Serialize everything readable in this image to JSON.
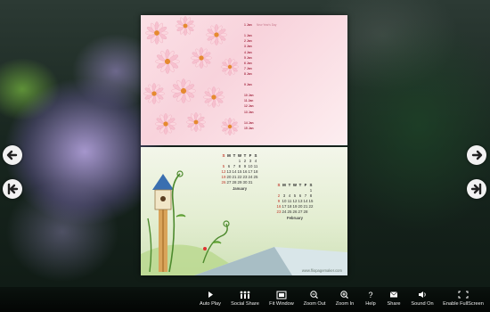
{
  "navigation": {
    "prev_icon": "arrow-left-icon",
    "first_icon": "skip-first-icon",
    "next_icon": "arrow-right-icon",
    "last_icon": "skip-last-icon"
  },
  "book": {
    "schedule": [
      {
        "date": "1 Jan",
        "text": "New Year's Day"
      },
      {
        "date": "",
        "text": ""
      },
      {
        "date": "1 Jan",
        "text": ""
      },
      {
        "date": "2 Jan",
        "text": ""
      },
      {
        "date": "3 Jan",
        "text": ""
      },
      {
        "date": "4 Jan",
        "text": ""
      },
      {
        "date": "5 Jan",
        "text": ""
      },
      {
        "date": "6 Jan",
        "text": ""
      },
      {
        "date": "7 Jan",
        "text": ""
      },
      {
        "date": "8 Jan",
        "text": ""
      },
      {
        "date": "",
        "text": ""
      },
      {
        "date": "9 Jan",
        "text": ""
      },
      {
        "date": "",
        "text": ""
      },
      {
        "date": "10 Jan",
        "text": ""
      },
      {
        "date": "11 Jan",
        "text": ""
      },
      {
        "date": "12 Jan",
        "text": ""
      },
      {
        "date": "13 Jan",
        "text": ""
      },
      {
        "date": "",
        "text": ""
      },
      {
        "date": "14 Jan",
        "text": ""
      },
      {
        "date": "15 Jan",
        "text": ""
      }
    ],
    "calendars": [
      {
        "month": "January",
        "headers": [
          "S",
          "M",
          "T",
          "W",
          "T",
          "F",
          "S"
        ],
        "days": [
          "",
          "",
          "",
          "1",
          "2",
          "3",
          "4",
          "5",
          "6",
          "7",
          "8",
          "9",
          "10",
          "11",
          "12",
          "13",
          "14",
          "15",
          "16",
          "17",
          "18",
          "19",
          "20",
          "21",
          "22",
          "23",
          "24",
          "25",
          "26",
          "27",
          "28",
          "29",
          "30",
          "31"
        ]
      },
      {
        "month": "February",
        "headers": [
          "S",
          "M",
          "T",
          "W",
          "T",
          "F",
          "S"
        ],
        "days": [
          "",
          "",
          "",
          "",
          "",
          "",
          "1",
          "2",
          "3",
          "4",
          "5",
          "6",
          "7",
          "8",
          "9",
          "10",
          "11",
          "12",
          "13",
          "14",
          "15",
          "16",
          "17",
          "18",
          "19",
          "20",
          "21",
          "22",
          "23",
          "24",
          "25",
          "26",
          "27",
          "28"
        ]
      }
    ],
    "watermark": "www.fliopagemaker.com"
  },
  "toolbar": {
    "items": [
      {
        "label": "Auto Play",
        "icon": "play-icon"
      },
      {
        "label": "Social Share",
        "icon": "people-icon"
      },
      {
        "label": "Fit Window",
        "icon": "fit-window-icon"
      },
      {
        "label": "Zoom Out",
        "icon": "zoom-out-icon"
      },
      {
        "label": "Zoom In",
        "icon": "zoom-in-icon"
      },
      {
        "label": "Help",
        "icon": "help-icon"
      },
      {
        "label": "Share",
        "icon": "mail-icon"
      },
      {
        "label": "Sound On",
        "icon": "speaker-icon"
      },
      {
        "label": "Enable FullScreen",
        "icon": "fullscreen-icon"
      }
    ]
  }
}
